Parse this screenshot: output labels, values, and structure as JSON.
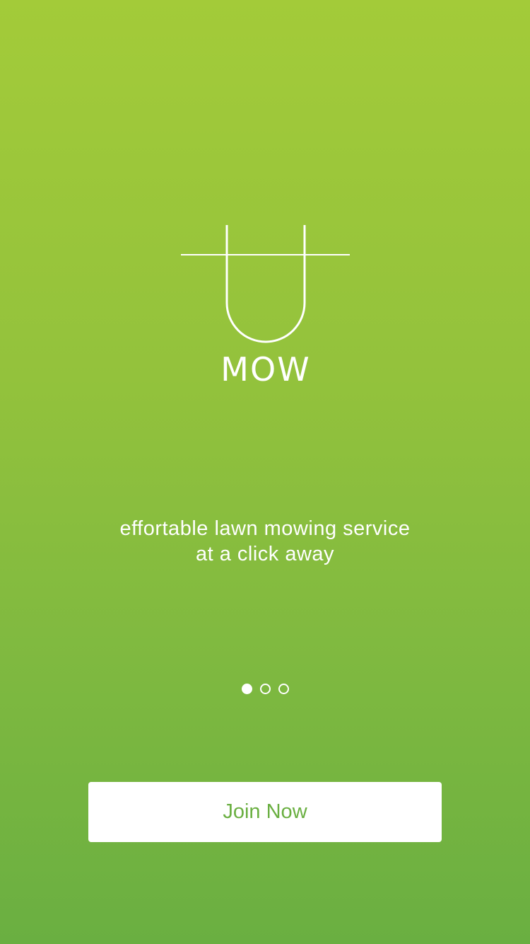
{
  "app": {
    "logo": {
      "letter": "U",
      "word": "MOW"
    },
    "tagline": {
      "line1": "effortable lawn mowing service",
      "line2": "at a click away"
    },
    "pager": {
      "total": 3,
      "current": 1
    },
    "join_button_label": "Join Now",
    "colors": {
      "gradient_top": "#a3cb39",
      "gradient_bottom": "#6aaf41",
      "button_text": "#6aaf41",
      "foreground": "#ffffff"
    }
  }
}
